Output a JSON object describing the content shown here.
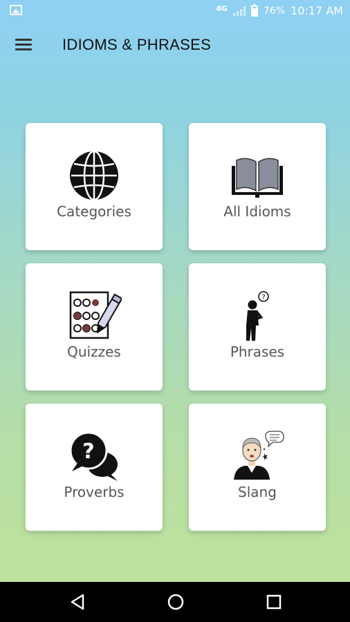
{
  "status_bar": {
    "network": "4G",
    "battery": "76%",
    "battery_level": 0.76,
    "time": "10:17 AM"
  },
  "app_bar": {
    "title": "IDIOMS & PHRASES",
    "menu_icon": "hamburger-menu-icon"
  },
  "tiles": [
    {
      "label": "Categories",
      "icon": "globe-icon"
    },
    {
      "label": "All Idioms",
      "icon": "open-book-icon"
    },
    {
      "label": "Quizzes",
      "icon": "quiz-sheet-pen-icon"
    },
    {
      "label": "Phrases",
      "icon": "thinking-person-icon"
    },
    {
      "label": "Proverbs",
      "icon": "question-chat-bubbles-icon"
    },
    {
      "label": "Slang",
      "icon": "talking-man-icon"
    }
  ],
  "nav_bar": {
    "icons": [
      "back-triangle-icon",
      "home-circle-icon",
      "recents-square-icon"
    ]
  },
  "colors": {
    "gradient_top": "#8fd0f3",
    "gradient_bottom": "#c0e29a",
    "tile_bg": "#ffffff",
    "tile_label": "#555555",
    "nav_bar": "#000000"
  }
}
